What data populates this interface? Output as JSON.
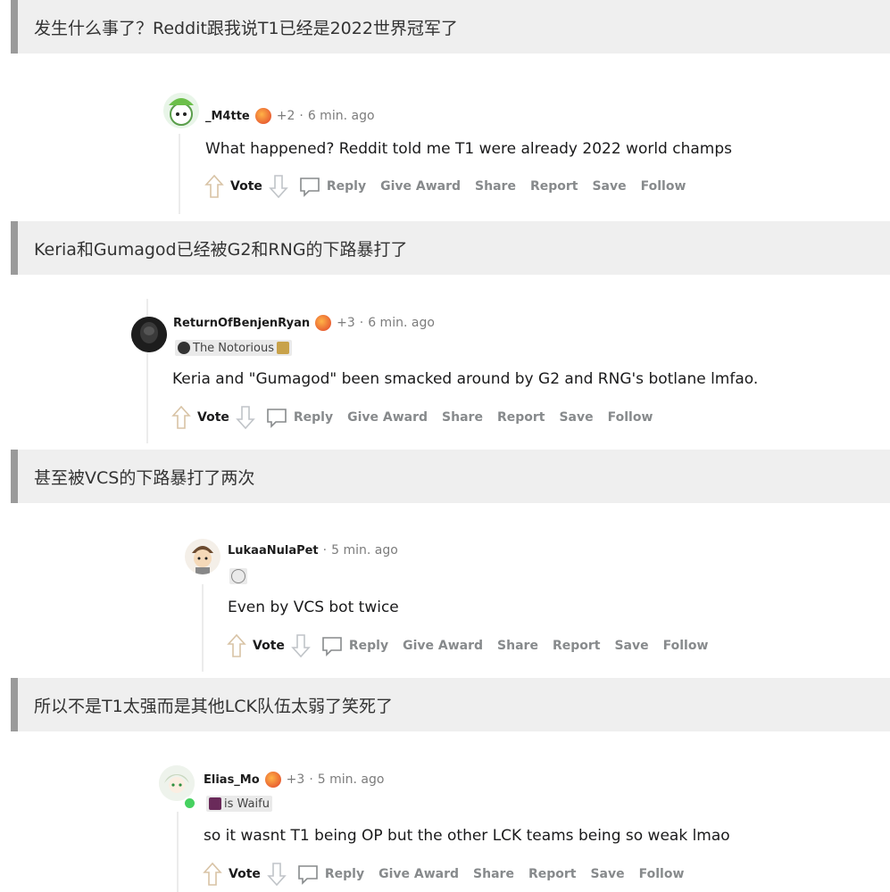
{
  "banners": [
    "发生什么事了？Reddit跟我说T1已经是2022世界冠军了",
    "Keria和Gumagod已经被G2和RNG的下路暴打了",
    "甚至被VCS的下路暴打了两次",
    "所以不是T1太强而是其他LCK队伍太弱了笑死了"
  ],
  "comments": [
    {
      "username": "_M4tte",
      "score": "+2",
      "time": "6 min. ago",
      "flair": "",
      "body": "What happened? Reddit told me T1 were already 2022 world champs"
    },
    {
      "username": "ReturnOfBenjenRyan",
      "score": "+3",
      "time": "6 min. ago",
      "flair": "The Notorious",
      "body": "Keria and \"Gumagod\" been smacked around by G2 and RNG's botlane lmfao."
    },
    {
      "username": "LukaaNulaPet",
      "score": "",
      "time": "5 min. ago",
      "flair": "",
      "body": "Even by VCS bot twice"
    },
    {
      "username": "Elias_Mo",
      "score": "+3",
      "time": "5 min. ago",
      "flair": "is Waifu",
      "body": "so it wasnt T1 being OP but the other LCK teams being so weak lmao"
    }
  ],
  "actions": {
    "vote": "Vote",
    "reply": "Reply",
    "give_award": "Give Award",
    "share": "Share",
    "report": "Report",
    "save": "Save",
    "follow": "Follow"
  },
  "separator": "·",
  "icons": [
    "upvote-icon",
    "downvote-icon",
    "reply-icon",
    "award-icon",
    "avatar"
  ]
}
